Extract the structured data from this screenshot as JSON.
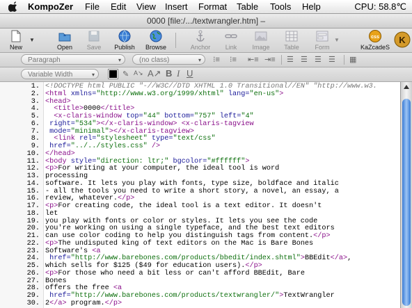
{
  "menubar": {
    "app": "KompoZer",
    "items": [
      "File",
      "Edit",
      "View",
      "Insert",
      "Format",
      "Table",
      "Tools",
      "Help"
    ],
    "cpu": "CPU:  58.8℃"
  },
  "window": {
    "title": "0000 [file:/.../textwrangler.htm] –"
  },
  "toolbar": {
    "buttons": [
      {
        "label": "New",
        "icon": "new-document-icon",
        "enabled": true
      },
      {
        "label": "Open",
        "icon": "open-folder-icon",
        "enabled": true
      },
      {
        "label": "Save",
        "icon": "save-icon",
        "enabled": false
      },
      {
        "label": "Publish",
        "icon": "publish-globe-icon",
        "enabled": true
      },
      {
        "label": "Browse",
        "icon": "browse-globe-icon",
        "enabled": true
      },
      {
        "label": "Anchor",
        "icon": "anchor-icon",
        "enabled": false
      },
      {
        "label": "Link",
        "icon": "link-icon",
        "enabled": false
      },
      {
        "label": "Image",
        "icon": "image-icon",
        "enabled": false
      },
      {
        "label": "Table",
        "icon": "table-icon",
        "enabled": false
      },
      {
        "label": "Form",
        "icon": "form-icon",
        "enabled": false
      },
      {
        "label": "KaZcadeS",
        "icon": "css-editor-icon",
        "enabled": true
      }
    ]
  },
  "format": {
    "paragraph_select": "Paragraph",
    "class_select": "(no class)",
    "font_select": "Variable Width"
  },
  "editor": {
    "lines": [
      {
        "n": "1.",
        "html": "<span class=\"cm\">&lt;!DOCTYPE html PUBLIC \"-//W3C//DTD XHTML 1.0 Transitional//EN\" \"http://www.w3.</span>"
      },
      {
        "n": "2.",
        "html": "<span class=\"tg\">&lt;html</span> <span class=\"at\">xmlns=</span><span class=\"va\">\"http://www.w3.org/1999/xhtml\"</span> <span class=\"at\">lang=</span><span class=\"va\">\"en-us\"</span><span class=\"tg\">&gt;</span>"
      },
      {
        "n": "3.",
        "html": "<span class=\"tg\">&lt;head&gt;</span>"
      },
      {
        "n": "4.",
        "html": "  <span class=\"tg\">&lt;title&gt;</span>0000<span class=\"tg\">&lt;/title&gt;</span>"
      },
      {
        "n": "5.",
        "html": "  <span class=\"tg\">&lt;x-claris-window</span> <span class=\"at\">top=</span><span class=\"va\">\"44\"</span> <span class=\"at\">bottom=</span><span class=\"va\">\"757\"</span> <span class=\"at\">left=</span><span class=\"va\">\"4\"</span>"
      },
      {
        "n": "6.",
        "html": " <span class=\"at\">right=</span><span class=\"va\">\"534\"</span><span class=\"tg\">&gt;&lt;/x-claris-window&gt;</span> <span class=\"tg\">&lt;x-claris-tagview</span>"
      },
      {
        "n": "7.",
        "html": " <span class=\"at\">mode=</span><span class=\"va\">\"minimal\"</span><span class=\"tg\">&gt;&lt;/x-claris-tagview&gt;</span>"
      },
      {
        "n": "8.",
        "html": "  <span class=\"tg\">&lt;link</span> <span class=\"at\">rel=</span><span class=\"va\">\"stylesheet\"</span> <span class=\"at\">type=</span><span class=\"va\">\"text/css\"</span>"
      },
      {
        "n": "9.",
        "html": " <span class=\"at\">href=</span><span class=\"va\">\"../../styles.css\"</span> <span class=\"tg\">/&gt;</span>"
      },
      {
        "n": "10.",
        "html": "<span class=\"tg\">&lt;/head&gt;</span>"
      },
      {
        "n": "11.",
        "html": "<span class=\"tg\">&lt;body</span> <span class=\"at\">style=</span><span class=\"va\">\"direction: ltr;\"</span> <span class=\"at\">bgcolor=</span><span class=\"va\">\"#ffffff\"</span><span class=\"tg\">&gt;</span>"
      },
      {
        "n": "12.",
        "html": "<span class=\"tg\">&lt;p&gt;</span>For writing at your computer, the ideal tool is word"
      },
      {
        "n": "13.",
        "html": "processing"
      },
      {
        "n": "14.",
        "html": "software. It lets you play with fonts, type size, boldface and italic"
      },
      {
        "n": "15.",
        "html": "- all the tools you need to write a short story, a novel, an essay, a"
      },
      {
        "n": "16.",
        "html": "review, whatever.<span class=\"tg\">&lt;/p&gt;</span>"
      },
      {
        "n": "17.",
        "html": "<span class=\"tg\">&lt;p&gt;</span>For creating code, the ideal tool is a text editor. It doesn't"
      },
      {
        "n": "18.",
        "html": "let"
      },
      {
        "n": "19.",
        "html": "you play with fonts or color or styles. It lets you see the code"
      },
      {
        "n": "20.",
        "html": "you're working on using a single typeface, and the best text editors"
      },
      {
        "n": "21.",
        "html": "can use color coding to help you distinguish tags from content.<span class=\"tg\">&lt;/p&gt;</span>"
      },
      {
        "n": "22.",
        "html": "<span class=\"tg\">&lt;p&gt;</span>The undisputed king of text editors on the Mac is Bare Bones"
      },
      {
        "n": "23.",
        "html": "Software's <span class=\"tg\">&lt;a</span>"
      },
      {
        "n": "24.",
        "html": " <span class=\"at\">href=</span><span class=\"va\">\"http://www.barebones.com/products/bbedit/index.shtml\"</span><span class=\"tg\">&gt;</span>BBEdit<span class=\"tg\">&lt;/a&gt;</span>,"
      },
      {
        "n": "25.",
        "html": "which sells for $125 ($49 for education users).<span class=\"tg\">&lt;/p&gt;</span>"
      },
      {
        "n": "26.",
        "html": "<span class=\"tg\">&lt;p&gt;</span>For those who need a bit less or can't afford BBEdit, Bare"
      },
      {
        "n": "27.",
        "html": "Bones"
      },
      {
        "n": "28.",
        "html": "offers the free <span class=\"tg\">&lt;a</span>"
      },
      {
        "n": "29.",
        "html": " <span class=\"at\">href=</span><span class=\"va\">\"http://www.barebones.com/products/textwrangler/\"</span><span class=\"tg\">&gt;</span>TextWrangler"
      },
      {
        "n": "30.",
        "html": "2<span class=\"tg\">&lt;/a&gt;</span> program.<span class=\"tg\">&lt;/p&gt;</span>"
      }
    ]
  }
}
